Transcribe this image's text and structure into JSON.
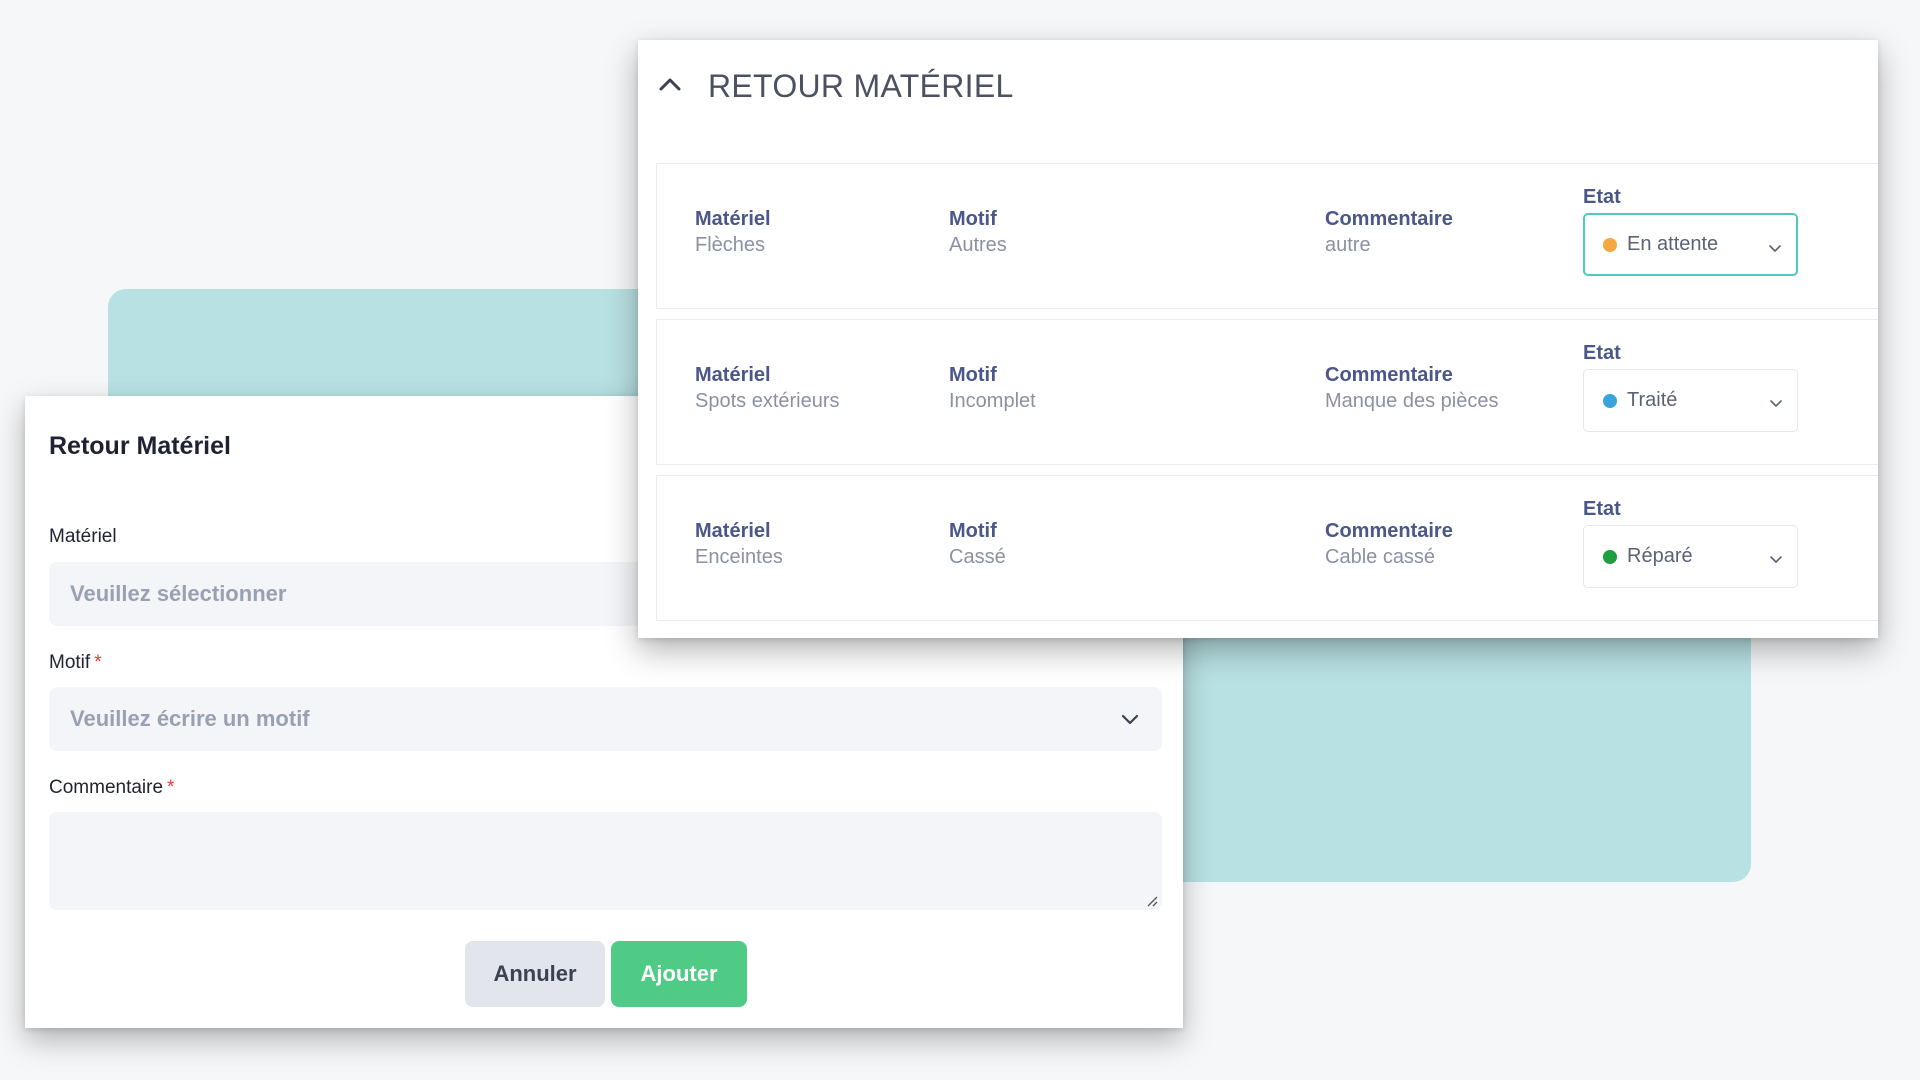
{
  "form": {
    "title": "Retour Matériel",
    "materiel_label": "Matériel",
    "materiel_placeholder": "Veuillez sélectionner",
    "motif_label": "Motif",
    "motif_placeholder": "Veuillez écrire un motif",
    "commentaire_label": "Commentaire",
    "required_mark": "*",
    "cancel_label": "Annuler",
    "add_label": "Ajouter"
  },
  "panel": {
    "title": "RETOUR MATÉRIEL",
    "collapse_icon": "chevron-up-icon",
    "columns": {
      "materiel": "Matériel",
      "motif": "Motif",
      "commentaire": "Commentaire",
      "etat": "Etat"
    },
    "rows": [
      {
        "materiel": "Flèches",
        "motif": "Autres",
        "commentaire": "autre",
        "etat": "En attente",
        "etat_color": "#f5a742",
        "focused": true
      },
      {
        "materiel": "Spots extérieurs",
        "motif": "Incomplet",
        "commentaire": "Manque des pièces",
        "etat": "Traité",
        "etat_color": "#3aa3db",
        "focused": false
      },
      {
        "materiel": "Enceintes",
        "motif": "Cassé",
        "commentaire": "Cable cassé",
        "etat": "Réparé",
        "etat_color": "#1e9e3e",
        "focused": false
      }
    ]
  },
  "colors": {
    "teal_backdrop": "#b8e1e3",
    "primary_button": "#4fcb86",
    "focus_border": "#50c9c0",
    "required": "#e53935"
  }
}
